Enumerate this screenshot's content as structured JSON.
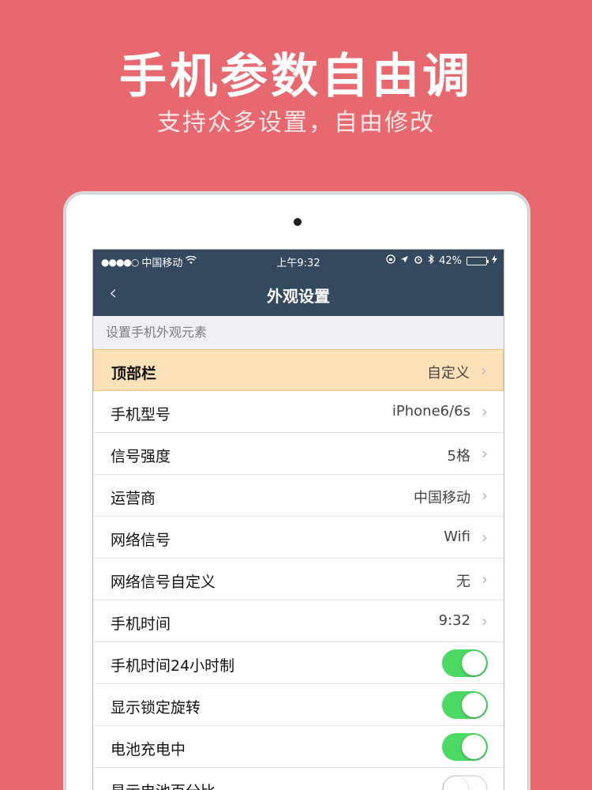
{
  "headline": "手机参数自由调",
  "subline": "支持众多设置，自由修改",
  "status_bar": {
    "signal": "●●●●○",
    "carrier": "中国移动",
    "wifi_icon": "wifi-icon",
    "time": "上午9:32",
    "battery_percent": "42%",
    "battery_level": 0.42
  },
  "nav": {
    "back_icon": "chevron-left-icon",
    "title": "外观设置"
  },
  "section_header": "设置手机外观元素",
  "rows": [
    {
      "label": "顶部栏",
      "value": "自定义",
      "type": "link",
      "highlight": true
    },
    {
      "label": "手机型号",
      "value": "iPhone6/6s",
      "type": "link"
    },
    {
      "label": "信号强度",
      "value": "5格",
      "type": "link"
    },
    {
      "label": "运营商",
      "value": "中国移动",
      "type": "link"
    },
    {
      "label": "网络信号",
      "value": "Wifi",
      "type": "link"
    },
    {
      "label": "网络信号自定义",
      "value": "无",
      "type": "link"
    },
    {
      "label": "手机时间",
      "value": "9:32",
      "type": "link"
    },
    {
      "label": "手机时间24小时制",
      "type": "toggle",
      "on": true
    },
    {
      "label": "显示锁定旋转",
      "type": "toggle",
      "on": true
    },
    {
      "label": "电池充电中",
      "type": "toggle",
      "on": true
    },
    {
      "label": "显示电池百分比",
      "type": "toggle",
      "on": false
    }
  ],
  "colors": {
    "background": "#e8686f",
    "nav_bar": "#34495e",
    "highlight_row": "#fde1b8",
    "toggle_on": "#4cd964"
  }
}
